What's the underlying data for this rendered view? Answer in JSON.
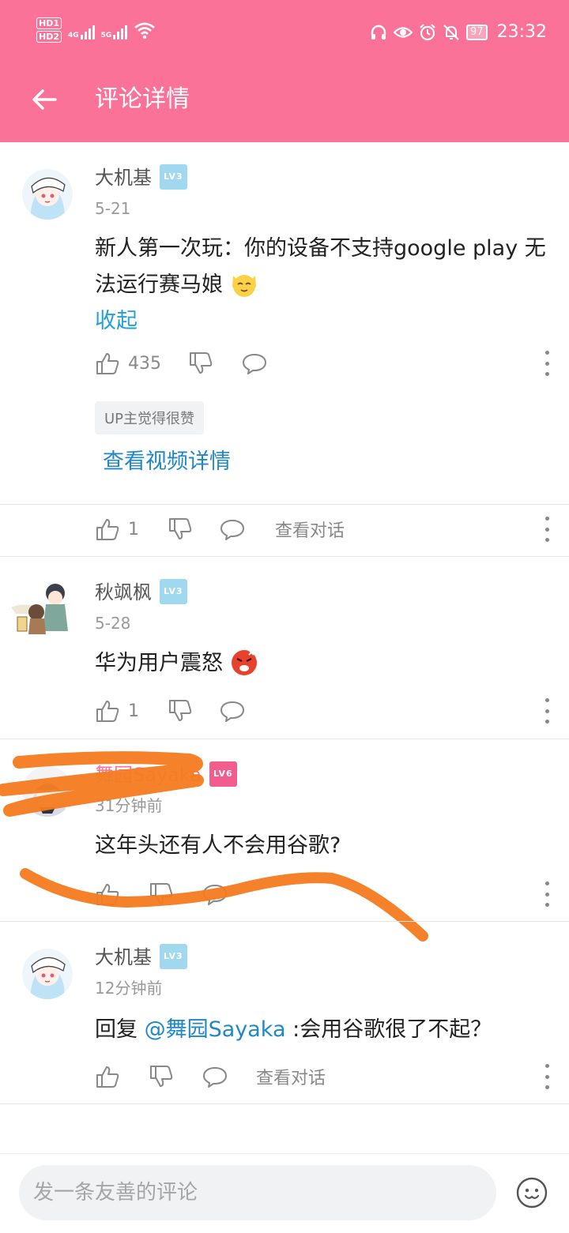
{
  "status": {
    "hd1": "HD1",
    "hd2": "HD2",
    "net1": "4G",
    "net2": "5G",
    "battery": "97",
    "time": "23:32"
  },
  "header": {
    "title": "评论详情"
  },
  "comments": [
    {
      "user": "大机基",
      "level": "LV3",
      "date": "5-21",
      "text": "新人第一次玩：你的设备不支持google play 无法运行赛马娘",
      "collapse_label": "收起",
      "likes": "435",
      "badge": "UP主觉得很赞",
      "view_video": "查看视频详情",
      "reply_likes": "1",
      "view_conversation": "查看对话"
    },
    {
      "user": "秋飒枫",
      "level": "LV3",
      "date": "5-28",
      "text": "华为用户震怒",
      "likes": "1"
    },
    {
      "user": "舞园Sayaka",
      "level": "LV6",
      "date": "31分钟前",
      "text": "这年头还有人不会用谷歌?"
    },
    {
      "user": "大机基",
      "level": "LV3",
      "date": "12分钟前",
      "reply_prefix": "回复 ",
      "mention": "@舞园Sayaka",
      "reply_text": " :会用谷歌很了不起？",
      "view_conversation": "查看对话"
    }
  ],
  "composer": {
    "placeholder": "发一条友善的评论"
  },
  "colors": {
    "accent": "#fb7299",
    "link": "#1e88c9",
    "scribble": "#f47b20"
  }
}
